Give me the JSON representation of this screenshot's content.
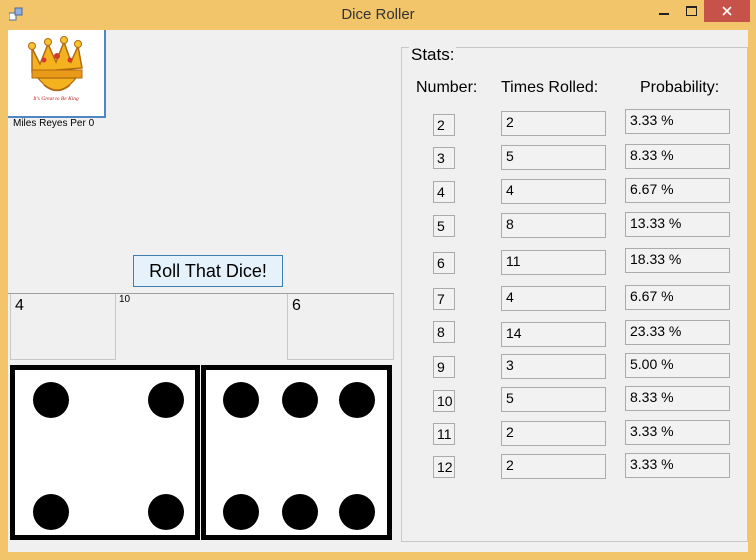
{
  "window": {
    "title": "Dice Roller"
  },
  "logo": {
    "caption": "Miles Reyes Per 0",
    "tagline": "It's Great to Be King"
  },
  "roll_button": {
    "label": "Roll That Dice!"
  },
  "dice": {
    "die1_value": "4",
    "sum_value": "10",
    "die2_value": "6"
  },
  "stats": {
    "title": "Stats:",
    "headers": {
      "number": "Number:",
      "times_rolled": "Times Rolled:",
      "probability": "Probability:"
    },
    "rows": [
      {
        "number": "2",
        "times": "2",
        "prob": "3.33 %"
      },
      {
        "number": "3",
        "times": "5",
        "prob": "8.33 %"
      },
      {
        "number": "4",
        "times": "4",
        "prob": "6.67 %"
      },
      {
        "number": "5",
        "times": "8",
        "prob": "13.33 %"
      },
      {
        "number": "6",
        "times": "11",
        "prob": "18.33 %"
      },
      {
        "number": "7",
        "times": "4",
        "prob": "6.67 %"
      },
      {
        "number": "8",
        "times": "14",
        "prob": "23.33 %"
      },
      {
        "number": "9",
        "times": "3",
        "prob": "5.00 %"
      },
      {
        "number": "10",
        "times": "5",
        "prob": "8.33 %"
      },
      {
        "number": "11",
        "times": "2",
        "prob": "3.33 %"
      },
      {
        "number": "12",
        "times": "2",
        "prob": "3.33 %"
      }
    ]
  },
  "colors": {
    "title_bar": "#f2c56a",
    "close_button": "#c7524a",
    "client_bg": "#f0f0f0",
    "button_bg": "#e5f1fb"
  }
}
